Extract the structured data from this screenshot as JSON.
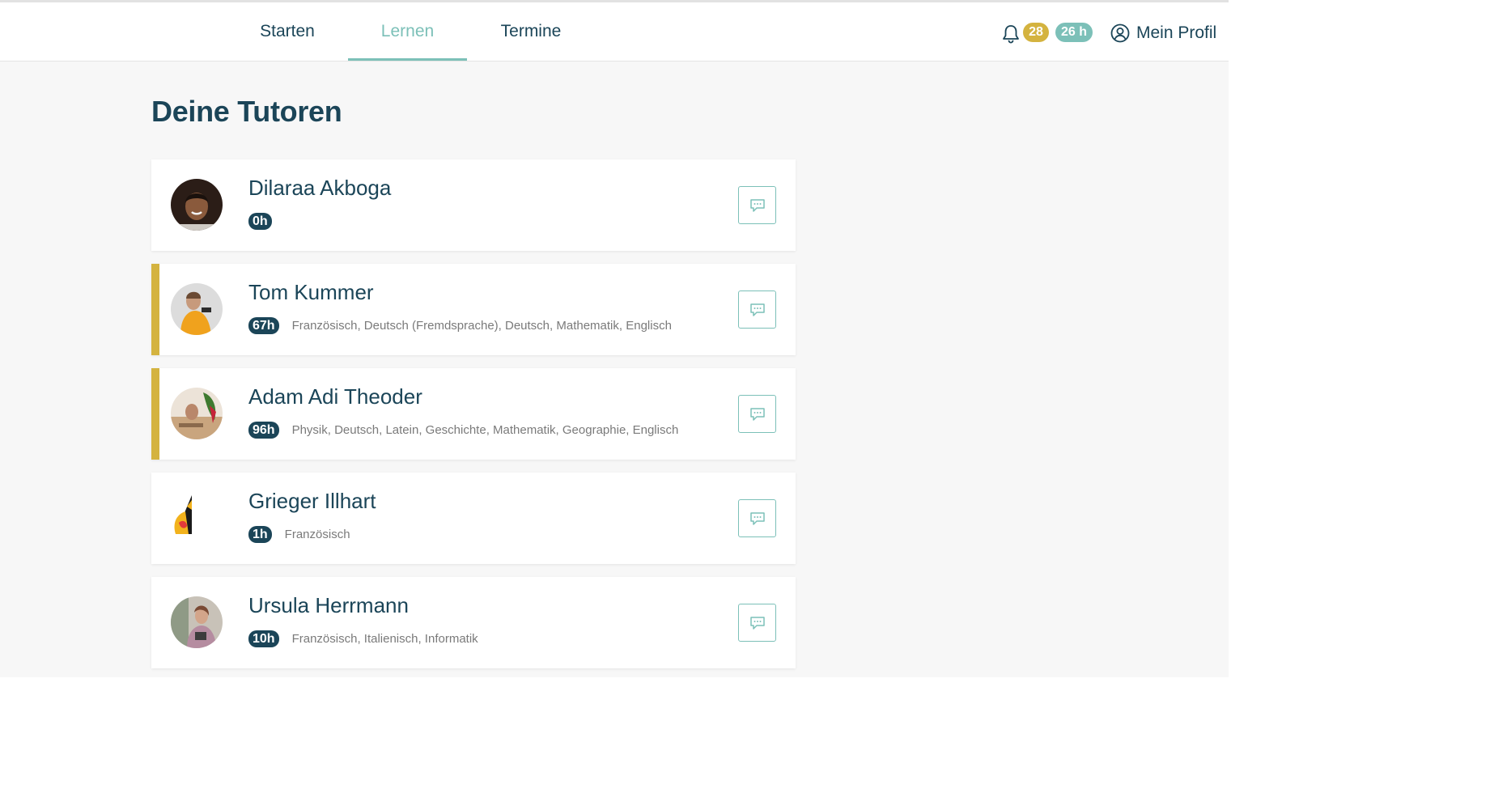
{
  "nav": {
    "tabs": [
      {
        "label": "Starten"
      },
      {
        "label": "Lernen"
      },
      {
        "label": "Termine"
      }
    ],
    "notification_count": "28",
    "hours_badge": "26 h",
    "profile_label": "Mein Profil"
  },
  "page": {
    "title": "Deine Tutoren"
  },
  "tutors": [
    {
      "name": "Dilaraa Akboga",
      "hours": "0h",
      "subjects": ""
    },
    {
      "name": "Tom Kummer",
      "hours": "67h",
      "subjects": "Französisch, Deutsch (Fremdsprache), Deutsch, Mathematik, Englisch"
    },
    {
      "name": "Adam Adi Theoder",
      "hours": "96h",
      "subjects": "Physik, Deutsch, Latein, Geschichte, Mathematik, Geographie, Englisch"
    },
    {
      "name": "Grieger Illhart",
      "hours": "1h",
      "subjects": "Französisch"
    },
    {
      "name": "Ursula Herrmann",
      "hours": "10h",
      "subjects": "Französisch, Italienisch, Informatik"
    }
  ],
  "colors": {
    "primary": "#1b4558",
    "accent": "#7cc0b8",
    "highlight": "#d4b33f",
    "background": "#f7f7f7"
  }
}
